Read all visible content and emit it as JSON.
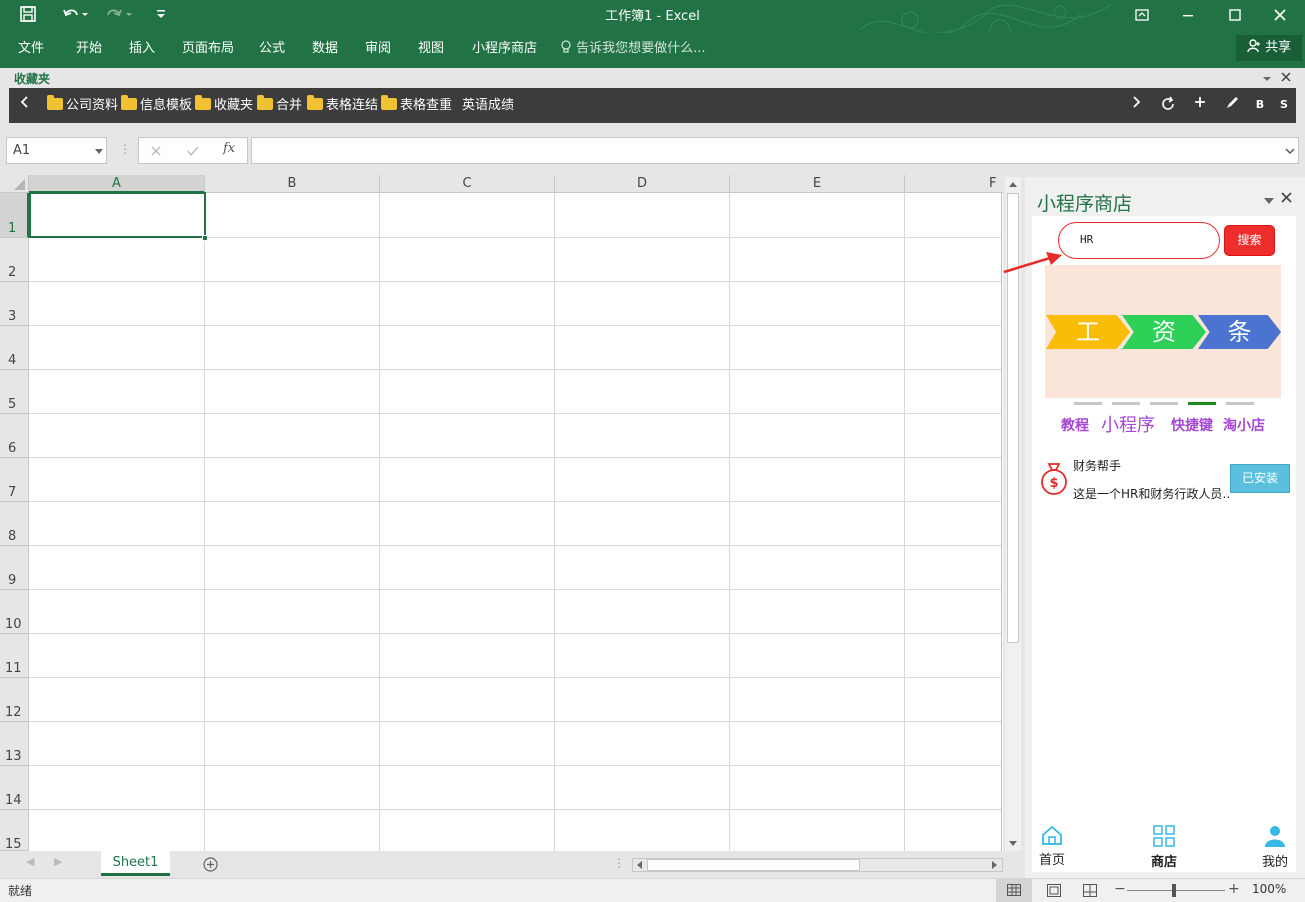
{
  "title": "工作簿1 - Excel",
  "ribbon_tabs": [
    "文件",
    "开始",
    "插入",
    "页面布局",
    "公式",
    "数据",
    "审阅",
    "视图",
    "小程序商店"
  ],
  "tell_me": "告诉我您想要做什么...",
  "share_label": "共享",
  "favorites_title": "收藏夹",
  "favorites": [
    "公司资料",
    "信息模板",
    "收藏夹",
    "合并",
    "表格连结",
    "表格查重"
  ],
  "favorites_extra": "英语成绩",
  "fav_tools": [
    "B",
    "S"
  ],
  "name_box": "A1",
  "fx_label": "fx",
  "columns": [
    "A",
    "B",
    "C",
    "D",
    "E",
    "F"
  ],
  "rows": [
    "1",
    "2",
    "3",
    "4",
    "5",
    "6",
    "7",
    "8",
    "9",
    "10",
    "11",
    "12",
    "13",
    "14",
    "15"
  ],
  "sheet_tab": "Sheet1",
  "status_text": "就绪",
  "zoom": "100%",
  "pane": {
    "title": "小程序商店",
    "search_value": "HR",
    "search_button": "搜索",
    "banner": [
      "工",
      "资",
      "条"
    ],
    "banner_colors": [
      "#fbbc05",
      "#2ed158",
      "#4a74d0"
    ],
    "carousel_active_index": 3,
    "links": [
      "教程",
      "小程序",
      "快捷键",
      "淘小店"
    ],
    "app": {
      "name": "财务帮手",
      "desc": "这是一个HR和财务行政人员…",
      "button": "已安装"
    },
    "nav": [
      "首页",
      "商店",
      "我的"
    ]
  },
  "colors": {
    "excel_green": "#217346",
    "accent_red": "#e62b2b",
    "link_purple": "#a647d6"
  }
}
